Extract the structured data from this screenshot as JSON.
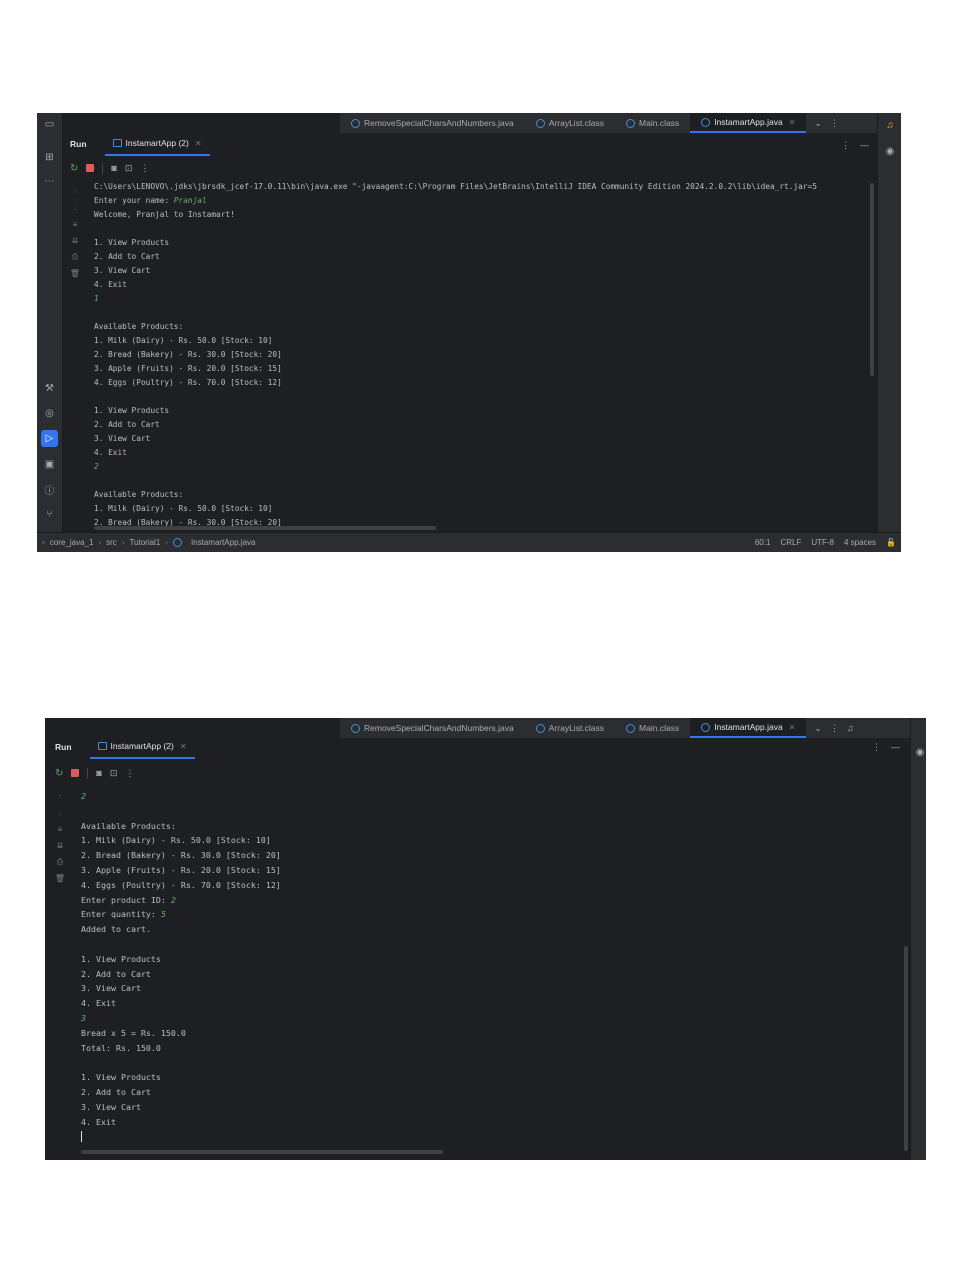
{
  "colors": {
    "bg": "#1e1f22",
    "panel": "#2b2d30",
    "accent": "#3574f0",
    "user_input": "#5fb865",
    "text": "#bcbec4",
    "stop": "#db5c5c",
    "rerun": "#59a869"
  },
  "editor_tabs": [
    {
      "label": "RemoveSpecialCharsAndNumbers.java",
      "icon": "java-class-icon",
      "active": false
    },
    {
      "label": "ArrayList.class",
      "icon": "class-file-icon",
      "active": false
    },
    {
      "label": "Main.class",
      "icon": "class-file-icon",
      "active": false
    },
    {
      "label": "InstamartApp.java",
      "icon": "java-class-icon",
      "active": true
    }
  ],
  "run_panel": {
    "title": "Run",
    "tab_label": "InstamartApp (2)"
  },
  "screen1": {
    "console_lines": [
      {
        "text": "C:\\Users\\LENOVO\\.jdks\\jbrsdk_jcef-17.0.11\\bin\\java.exe \"-javaagent:C:\\Program Files\\JetBrains\\IntelliJ IDEA Community Edition 2024.2.0.2\\lib\\idea_rt.jar=5",
        "input": ""
      },
      {
        "text": "Enter your name: ",
        "input": "Pranjal"
      },
      {
        "text": "Welcome, Pranjal to Instamart!",
        "input": ""
      },
      {
        "text": "",
        "input": ""
      },
      {
        "text": "1. View Products",
        "input": ""
      },
      {
        "text": "2. Add to Cart",
        "input": ""
      },
      {
        "text": "3. View Cart",
        "input": ""
      },
      {
        "text": "4. Exit",
        "input": ""
      },
      {
        "text": "",
        "input": "1"
      },
      {
        "text": "",
        "input": ""
      },
      {
        "text": "Available Products:",
        "input": ""
      },
      {
        "text": "1. Milk (Dairy) - Rs. 50.0 [Stock: 10]",
        "input": ""
      },
      {
        "text": "2. Bread (Bakery) - Rs. 30.0 [Stock: 20]",
        "input": ""
      },
      {
        "text": "3. Apple (Fruits) - Rs. 20.0 [Stock: 15]",
        "input": ""
      },
      {
        "text": "4. Eggs (Poultry) - Rs. 70.0 [Stock: 12]",
        "input": ""
      },
      {
        "text": "",
        "input": ""
      },
      {
        "text": "1. View Products",
        "input": ""
      },
      {
        "text": "2. Add to Cart",
        "input": ""
      },
      {
        "text": "3. View Cart",
        "input": ""
      },
      {
        "text": "4. Exit",
        "input": ""
      },
      {
        "text": "",
        "input": "2"
      },
      {
        "text": "",
        "input": ""
      },
      {
        "text": "Available Products:",
        "input": ""
      },
      {
        "text": "1. Milk (Dairy) - Rs. 50.0 [Stock: 10]",
        "input": ""
      },
      {
        "text": "2. Bread (Bakery) - Rs. 30.0 [Stock: 20]",
        "input": ""
      }
    ],
    "breadcrumb": [
      "core_java_1",
      "src",
      "Tutorial1",
      "InstamartApp.java"
    ],
    "status": {
      "position": "60:1",
      "line_sep": "CRLF",
      "encoding": "UTF-8",
      "indent": "4 spaces"
    }
  },
  "screen2": {
    "console_lines": [
      {
        "text": "",
        "input": "2"
      },
      {
        "text": "",
        "input": ""
      },
      {
        "text": "Available Products:",
        "input": ""
      },
      {
        "text": "1. Milk (Dairy) - Rs. 50.0 [Stock: 10]",
        "input": ""
      },
      {
        "text": "2. Bread (Bakery) - Rs. 30.0 [Stock: 20]",
        "input": ""
      },
      {
        "text": "3. Apple (Fruits) - Rs. 20.0 [Stock: 15]",
        "input": ""
      },
      {
        "text": "4. Eggs (Poultry) - Rs. 70.0 [Stock: 12]",
        "input": ""
      },
      {
        "text": "Enter product ID: ",
        "input": "2"
      },
      {
        "text": "Enter quantity: ",
        "input": "5"
      },
      {
        "text": "Added to cart.",
        "input": ""
      },
      {
        "text": "",
        "input": ""
      },
      {
        "text": "1. View Products",
        "input": ""
      },
      {
        "text": "2. Add to Cart",
        "input": ""
      },
      {
        "text": "3. View Cart",
        "input": ""
      },
      {
        "text": "4. Exit",
        "input": ""
      },
      {
        "text": "",
        "input": "3"
      },
      {
        "text": "Bread x 5 = Rs. 150.0",
        "input": ""
      },
      {
        "text": "Total: Rs. 150.0",
        "input": ""
      },
      {
        "text": "",
        "input": ""
      },
      {
        "text": "1. View Products",
        "input": ""
      },
      {
        "text": "2. Add to Cart",
        "input": ""
      },
      {
        "text": "3. View Cart",
        "input": ""
      },
      {
        "text": "4. Exit",
        "input": ""
      }
    ]
  }
}
